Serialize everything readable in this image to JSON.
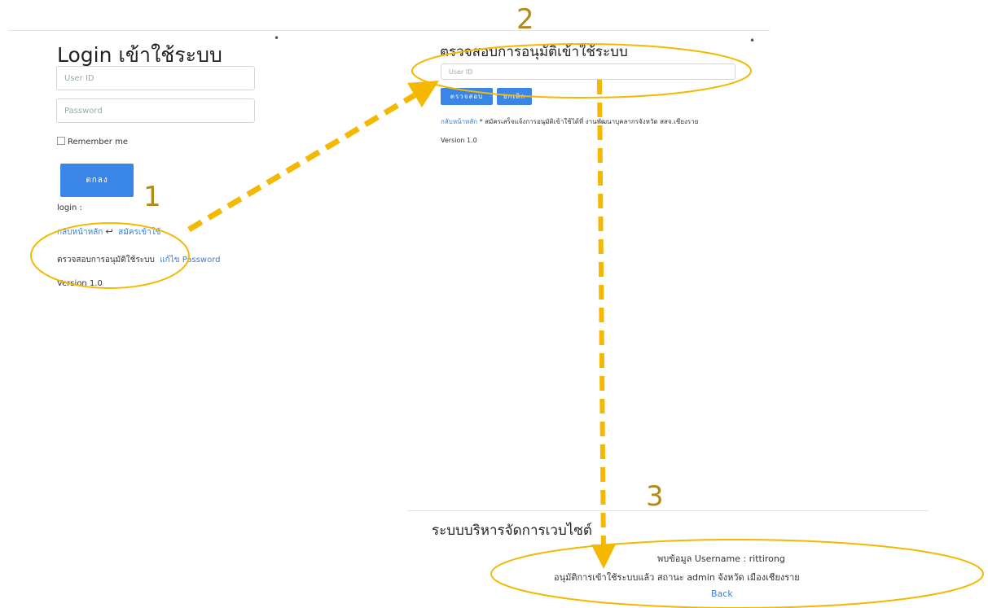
{
  "steps": [
    "1",
    "2",
    "3"
  ],
  "colors": {
    "accent": "#f5b800",
    "button": "#3a86e8",
    "link": "#3a7fd9",
    "step_number": "#b08a1a"
  },
  "login": {
    "title": "Login เข้าใช้ระบบ",
    "userid_placeholder": "User ID",
    "password_placeholder": "Password",
    "remember_label": "Remember me",
    "submit_label": "ตกลง",
    "status_label": "login :",
    "back_home": "กลับหน้าหลัก",
    "back_icon": "reply-arrow-icon",
    "register": "สมัครเข้าใช้",
    "check_approval": "ตรวจสอบการอนุมัติใช้ระบบ",
    "edit_password": "แก้ไข Password",
    "version": "Version 1.0"
  },
  "check": {
    "title": "ตรวจสอบการอนุมัติเข้าใช้ระบบ",
    "userid_placeholder": "User ID",
    "check_button": "ตรวจสอบ",
    "cancel_button": "ยกเลิก",
    "back_home": "กลับหน้าหลัก",
    "note": "* สมัครเสร็จแจ้งการอนุมัติเข้าใช้ได้ที่ งานพัฒนาบุคลากรจังหวัด สสจ.เชียงราย",
    "version": "Version 1.0"
  },
  "result": {
    "title": "ระบบบริหารจัดการเวบไซต์",
    "found_line": "พบข้อมูล Username : rittirong",
    "status_line": "อนุมัติการเข้าใช้ระบบแล้ว สถานะ admin จังหวัด เมืองเชียงราย",
    "back_link": "Back"
  }
}
